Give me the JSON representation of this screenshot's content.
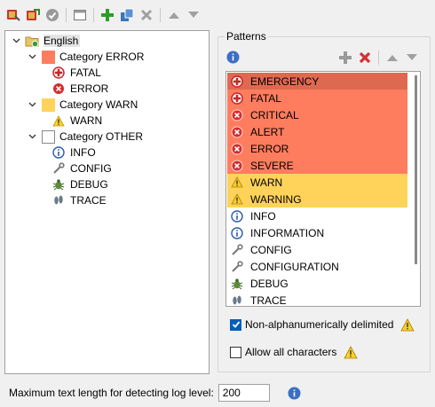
{
  "toolbar": {
    "buttons": [
      {
        "icon": "import-icon"
      },
      {
        "icon": "export-icon"
      },
      {
        "icon": "check-icon"
      },
      {
        "icon": "window-icon"
      },
      {
        "icon": "add-icon"
      },
      {
        "icon": "copy-icon"
      },
      {
        "icon": "delete-icon"
      },
      {
        "icon": "up-arrow-icon"
      },
      {
        "icon": "down-arrow-icon"
      }
    ]
  },
  "tree": {
    "language": "English",
    "categories": [
      {
        "label": "Category ERROR",
        "color": "#ff7d5f",
        "items": [
          "FATAL",
          "ERROR"
        ]
      },
      {
        "label": "Category WARN",
        "color": "#ffd35a",
        "items": [
          "WARN"
        ]
      },
      {
        "label": "Category OTHER",
        "color": "#ffffff",
        "items": [
          "INFO",
          "CONFIG",
          "DEBUG",
          "TRACE"
        ]
      }
    ]
  },
  "patterns": {
    "title": "Patterns",
    "items": [
      {
        "label": "EMERGENCY",
        "icon": "fatal-icon",
        "bg": "#dd6a50"
      },
      {
        "label": "FATAL",
        "icon": "fatal-icon",
        "bg": "#ff7d5f"
      },
      {
        "label": "CRITICAL",
        "icon": "error-icon",
        "bg": "#ff7d5f"
      },
      {
        "label": "ALERT",
        "icon": "error-icon",
        "bg": "#ff7d5f"
      },
      {
        "label": "ERROR",
        "icon": "error-icon",
        "bg": "#ff7d5f"
      },
      {
        "label": "SEVERE",
        "icon": "error-icon",
        "bg": "#ff7d5f"
      },
      {
        "label": "WARN",
        "icon": "warning-icon",
        "bg": "#ffd35a"
      },
      {
        "label": "WARNING",
        "icon": "warning-icon",
        "bg": "#ffd35a"
      },
      {
        "label": "INFO",
        "icon": "info-icon",
        "bg": "#ffffff"
      },
      {
        "label": "INFORMATION",
        "icon": "info-icon",
        "bg": "#ffffff"
      },
      {
        "label": "CONFIG",
        "icon": "wrench-icon",
        "bg": "#ffffff"
      },
      {
        "label": "CONFIGURATION",
        "icon": "wrench-icon",
        "bg": "#ffffff"
      },
      {
        "label": "DEBUG",
        "icon": "bug-icon",
        "bg": "#ffffff"
      },
      {
        "label": "TRACE",
        "icon": "footprints-icon",
        "bg": "#ffffff"
      }
    ],
    "non_alphanumeric_label": "Non-alphanumerically delimited",
    "non_alphanumeric_checked": true,
    "allow_all_label": "Allow all characters",
    "allow_all_checked": false
  },
  "bottom": {
    "max_length_label": "Maximum text length for detecting log level:",
    "max_length_value": "200"
  },
  "colors": {
    "error": "#ff7d5f",
    "error_selected": "#dd6a50",
    "warn": "#ffd35a",
    "accent": "#005fb8"
  }
}
